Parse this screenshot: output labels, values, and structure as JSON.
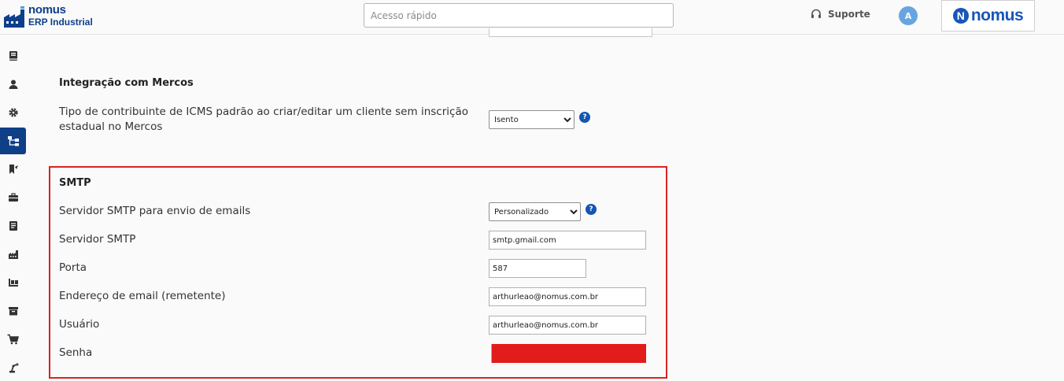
{
  "header": {
    "brand_name": "nomus",
    "brand_sub": "ERP Industrial",
    "search_placeholder": "Acesso rápido",
    "support_label": "Suporte",
    "avatar_initial": "A",
    "logo_text": "nomus",
    "logo_mark": "N"
  },
  "sidebar": {
    "items": [
      {
        "icon": "book-icon"
      },
      {
        "icon": "user-icon"
      },
      {
        "icon": "gear-icon"
      },
      {
        "icon": "integration-icon",
        "active": true
      },
      {
        "icon": "bookmark-icon"
      },
      {
        "icon": "briefcase-icon"
      },
      {
        "icon": "document-icon"
      },
      {
        "icon": "factory-icon"
      },
      {
        "icon": "pallet-icon"
      },
      {
        "icon": "archive-icon"
      },
      {
        "icon": "cart-icon"
      },
      {
        "icon": "robot-arm-icon"
      }
    ]
  },
  "mercos": {
    "title": "Integração com Mercos",
    "icms_label": "Tipo de contribuinte de ICMS padrão ao criar/editar um cliente sem inscrição estadual no Mercos",
    "icms_value": "Isento",
    "help": "?"
  },
  "smtp": {
    "title": "SMTP",
    "server_mode_label": "Servidor SMTP para envio de emails",
    "server_mode_value": "Personalizado",
    "server_label": "Servidor SMTP",
    "server_value": "smtp.gmail.com",
    "port_label": "Porta",
    "port_value": "587",
    "sender_label": "Endereço de email (remetente)",
    "sender_value": "arthurleao@nomus.com.br",
    "user_label": "Usuário",
    "user_value": "arthurleao@nomus.com.br",
    "password_label": "Senha",
    "help": "?"
  },
  "colors": {
    "brand_blue": "#0e3f8a",
    "sidebar_active": "#0f3f86",
    "help_blue": "#1456b3",
    "highlight_red": "#d92323"
  }
}
